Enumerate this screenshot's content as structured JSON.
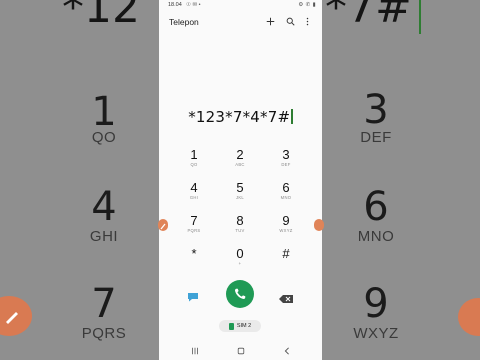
{
  "status": {
    "time": "18.04",
    "icons": "☉ ✉ •",
    "right": "⚙ ✆ ▮"
  },
  "app": {
    "title": "Telepon",
    "add_icon": "plus-icon",
    "search_icon": "search-icon",
    "more_icon": "more-vert-icon"
  },
  "dialer": {
    "number": "*123*7*4*7#"
  },
  "keypad": [
    {
      "digit": "1",
      "letters": "QO"
    },
    {
      "digit": "2",
      "letters": "ABC"
    },
    {
      "digit": "3",
      "letters": "DEF"
    },
    {
      "digit": "4",
      "letters": "GHI"
    },
    {
      "digit": "5",
      "letters": "JKL"
    },
    {
      "digit": "6",
      "letters": "MNO"
    },
    {
      "digit": "7",
      "letters": "PQRS"
    },
    {
      "digit": "8",
      "letters": "TUV"
    },
    {
      "digit": "9",
      "letters": "WXYZ"
    },
    {
      "digit": "*",
      "letters": ""
    },
    {
      "digit": "0",
      "letters": "+"
    },
    {
      "digit": "#",
      "letters": ""
    }
  ],
  "actions": {
    "sim_label": "SIM 2"
  },
  "background": {
    "top_text_left": "*12",
    "top_text_right": "*7#",
    "numbers": [
      {
        "digit": "1",
        "letters": "QO"
      },
      {
        "digit": "3",
        "letters": "DEF"
      },
      {
        "digit": "4",
        "letters": "GHI"
      },
      {
        "digit": "6",
        "letters": "MNO"
      },
      {
        "digit": "7",
        "letters": "PQRS"
      },
      {
        "digit": "9",
        "letters": "WXYZ"
      }
    ]
  },
  "colors": {
    "accent": "#1f9a55",
    "caret": "#2e7d32",
    "side_tab": "#e08458"
  }
}
